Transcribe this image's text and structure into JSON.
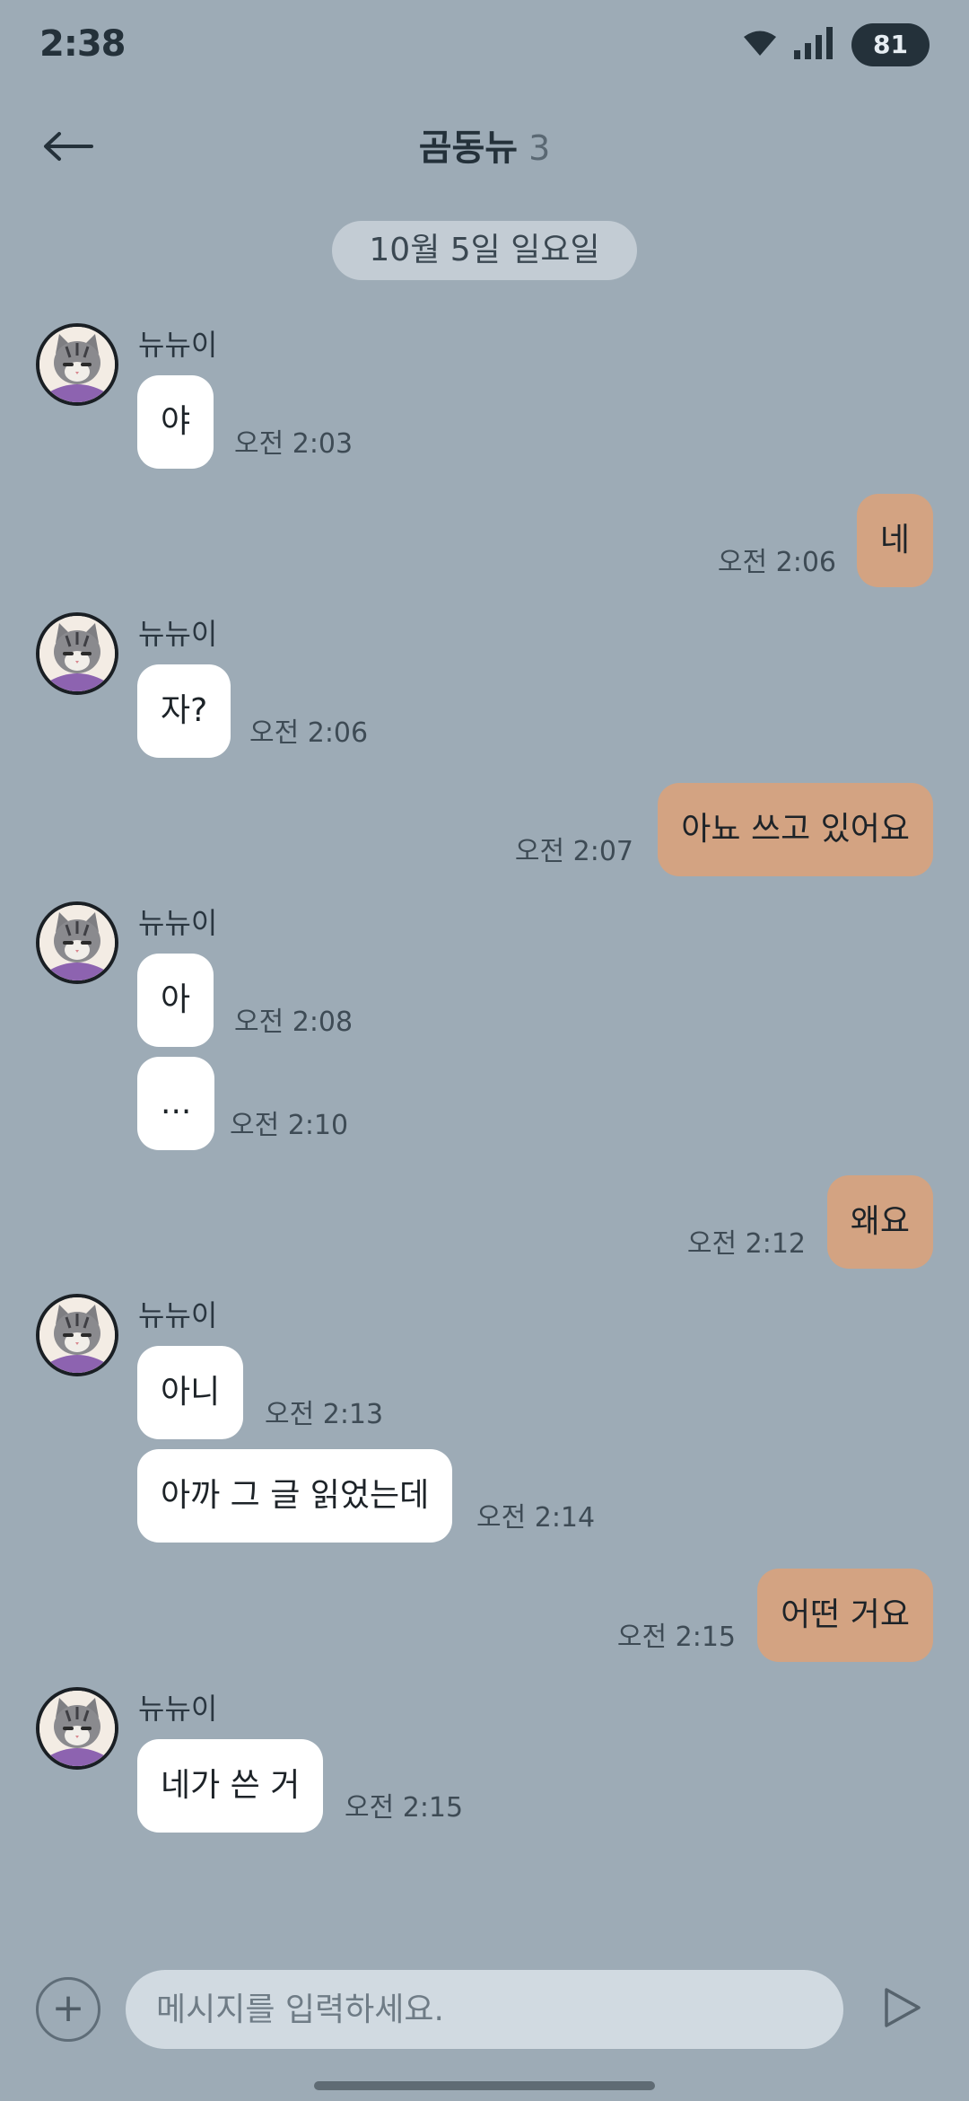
{
  "status_bar": {
    "time": "2:38",
    "battery": "81"
  },
  "header": {
    "title": "곰동뉴",
    "member_count": "3"
  },
  "date_divider": "10월 5일 일요일",
  "messages": {
    "m1": {
      "sender": "뉴뉴이",
      "text": "야",
      "time": "오전 2:03"
    },
    "m2": {
      "text": "네",
      "time": "오전 2:06"
    },
    "m3": {
      "sender": "뉴뉴이",
      "text": "자?",
      "time": "오전 2:06"
    },
    "m4": {
      "text": "아뇨 쓰고 있어요",
      "time": "오전 2:07"
    },
    "m5": {
      "sender": "뉴뉴이",
      "text": "아",
      "time": "오전 2:08"
    },
    "m6": {
      "text": "...",
      "time": "오전 2:10"
    },
    "m7": {
      "text": "왜요",
      "time": "오전 2:12"
    },
    "m8": {
      "sender": "뉴뉴이",
      "text": "아니",
      "time": "오전 2:13"
    },
    "m9": {
      "text": "아까 그 글 읽었는데",
      "time": "오전 2:14"
    },
    "m10": {
      "text": "어떤 거요",
      "time": "오전 2:15"
    },
    "m11": {
      "sender": "뉴뉴이",
      "text": "네가 쓴 거",
      "time": "오전 2:15"
    }
  },
  "composer": {
    "placeholder": "메시지를 입력하세요.",
    "plus_label": "+"
  },
  "colors": {
    "background": "#9dabb6",
    "incoming_bubble": "#ffffff",
    "outgoing_bubble": "#d3a382"
  },
  "icons": {
    "back": "back-arrow-icon",
    "wifi": "wifi-icon",
    "signal": "signal-icon",
    "send": "send-icon",
    "avatar": "cat-avatar"
  }
}
